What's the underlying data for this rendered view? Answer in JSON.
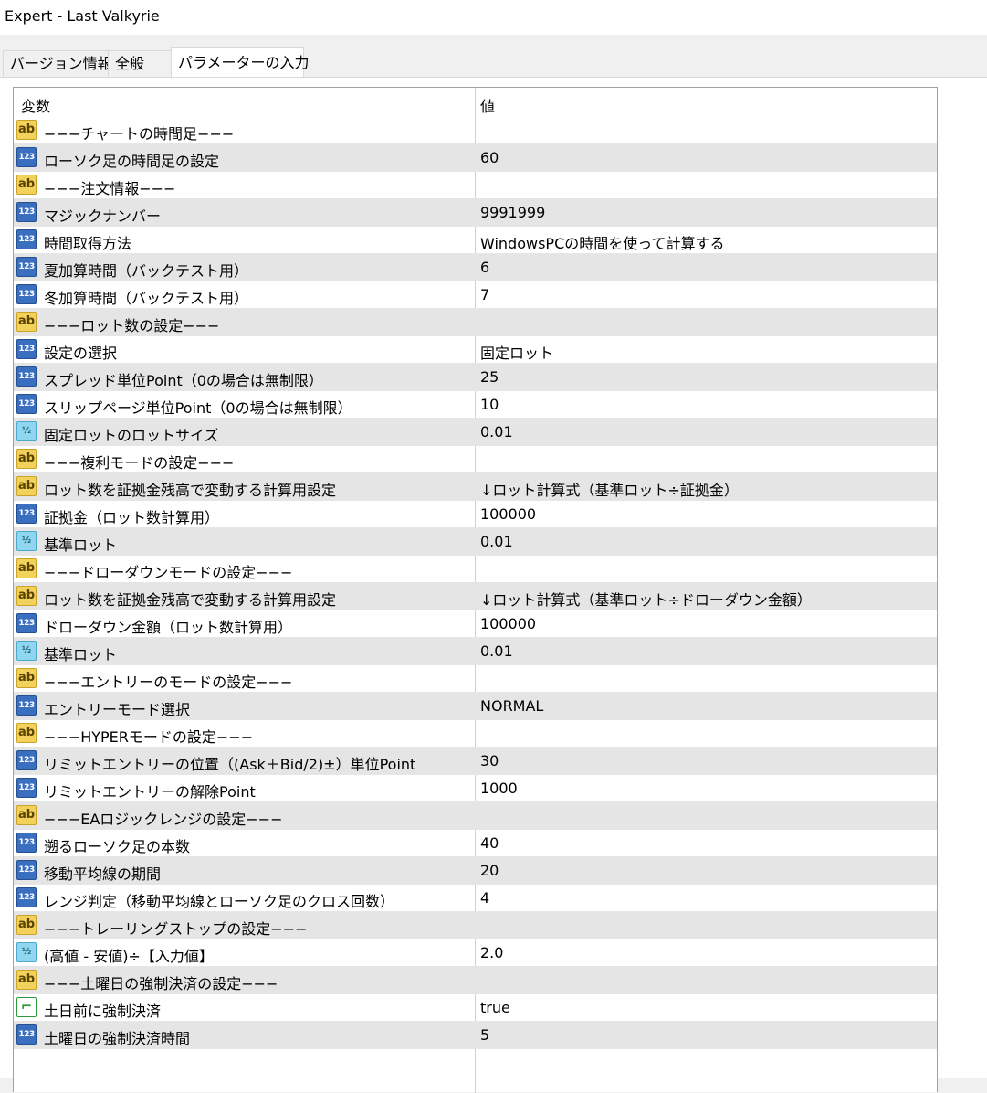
{
  "window": {
    "title": "Expert - Last Valkyrie"
  },
  "tabs": [
    {
      "label": "バージョン情報"
    },
    {
      "label": "全般"
    },
    {
      "label": "パラメーターの入力"
    }
  ],
  "grid": {
    "columns": {
      "name": "変数",
      "value": "値"
    },
    "rows": [
      {
        "type": "ab",
        "name": "−−−チャートの時間足−−−",
        "value": ""
      },
      {
        "type": "123",
        "name": "ローソク足の時間足の設定",
        "value": "60"
      },
      {
        "type": "ab",
        "name": "−−−注文情報−−−",
        "value": ""
      },
      {
        "type": "123",
        "name": "マジックナンバー",
        "value": "9991999"
      },
      {
        "type": "123",
        "name": "時間取得方法",
        "value": "WindowsPCの時間を使って計算する"
      },
      {
        "type": "123",
        "name": "夏加算時間（バックテスト用）",
        "value": "6"
      },
      {
        "type": "123",
        "name": "冬加算時間（バックテスト用）",
        "value": "7"
      },
      {
        "type": "ab",
        "name": "−−−ロット数の設定−−−",
        "value": ""
      },
      {
        "type": "123",
        "name": "設定の選択",
        "value": "固定ロット"
      },
      {
        "type": "123",
        "name": "スプレッド単位Point（0の場合は無制限）",
        "value": "25"
      },
      {
        "type": "123",
        "name": "スリップページ単位Point（0の場合は無制限）",
        "value": "10"
      },
      {
        "type": "half",
        "name": "固定ロットのロットサイズ",
        "value": "0.01"
      },
      {
        "type": "ab",
        "name": "−−−複利モードの設定−−−",
        "value": ""
      },
      {
        "type": "ab",
        "name": "ロット数を証拠金残高で変動する計算用設定",
        "value": "↓ロット計算式（基準ロット÷証拠金）"
      },
      {
        "type": "123",
        "name": "証拠金（ロット数計算用）",
        "value": "100000"
      },
      {
        "type": "half",
        "name": "基準ロット",
        "value": "0.01"
      },
      {
        "type": "ab",
        "name": "−−−ドローダウンモードの設定−−−",
        "value": ""
      },
      {
        "type": "ab",
        "name": "ロット数を証拠金残高で変動する計算用設定",
        "value": "↓ロット計算式（基準ロット÷ドローダウン金額）"
      },
      {
        "type": "123",
        "name": "ドローダウン金額（ロット数計算用）",
        "value": "100000"
      },
      {
        "type": "half",
        "name": "基準ロット",
        "value": "0.01"
      },
      {
        "type": "ab",
        "name": "−−−エントリーのモードの設定−−−",
        "value": ""
      },
      {
        "type": "123",
        "name": "エントリーモード選択",
        "value": "NORMAL"
      },
      {
        "type": "ab",
        "name": "−−−HYPERモードの設定−−−",
        "value": ""
      },
      {
        "type": "123",
        "name": "リミットエントリーの位置（(Ask＋Bid/2)±）単位Point",
        "value": "30"
      },
      {
        "type": "123",
        "name": "リミットエントリーの解除Point",
        "value": "1000"
      },
      {
        "type": "ab",
        "name": "−−−EAロジックレンジの設定−−−",
        "value": ""
      },
      {
        "type": "123",
        "name": "遡るローソク足の本数",
        "value": "40"
      },
      {
        "type": "123",
        "name": "移動平均線の期間",
        "value": "20"
      },
      {
        "type": "123",
        "name": "レンジ判定（移動平均線とローソク足のクロス回数）",
        "value": "4"
      },
      {
        "type": "ab",
        "name": "−−−トレーリングストップの設定−−−",
        "value": ""
      },
      {
        "type": "half",
        "name": "(高値 - 安値)÷【入力値】",
        "value": "2.0"
      },
      {
        "type": "ab",
        "name": "−−−土曜日の強制決済の設定−−−",
        "value": ""
      },
      {
        "type": "bool",
        "name": "土日前に強制決済",
        "value": "true"
      },
      {
        "type": "123",
        "name": "土曜日の強制決済時間",
        "value": "5"
      }
    ]
  },
  "icons": {
    "ab": "string-type-icon",
    "123": "integer-type-icon",
    "half": "double-type-icon",
    "bool": "bool-type-icon"
  },
  "icon_glyphs": {
    "ab": "ab",
    "123": "123",
    "half": "½",
    "bool": "⌐"
  }
}
